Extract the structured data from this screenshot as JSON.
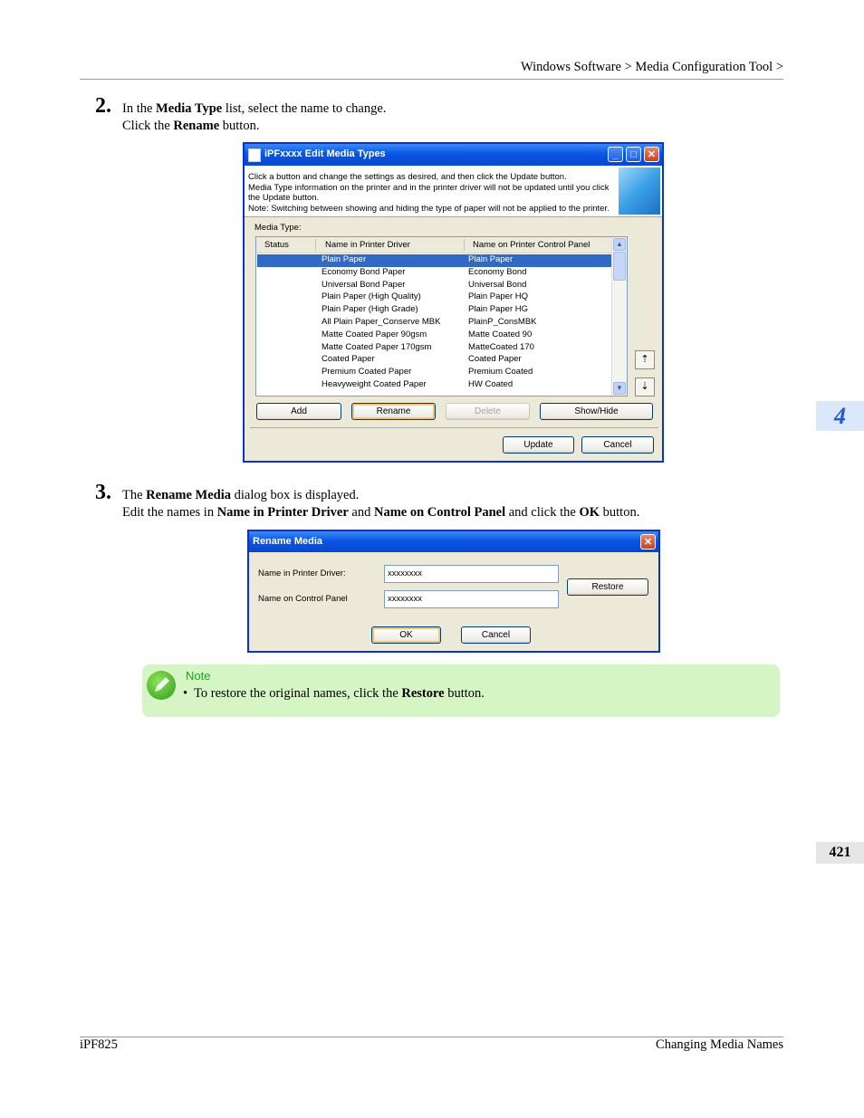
{
  "header": {
    "breadcrumb_1": "Windows Software",
    "sep_1": ">",
    "breadcrumb_2": "Media Configuration Tool",
    "sep_2": ">"
  },
  "step2": {
    "number": "2.",
    "line1_a": "In the ",
    "line1_b": "Media Type",
    "line1_c": " list, select the name to change.",
    "line2_a": "Click the ",
    "line2_b": "Rename",
    "line2_c": " button."
  },
  "dialog1": {
    "title": "iPFxxxx Edit Media Types",
    "info_line1": "Click a button and change the settings as desired, and then click the Update button.",
    "info_line2": "Media Type information on the printer and in the printer driver will not be updated until you click",
    "info_line3": "the Update button.",
    "info_line4": "Note: Switching between showing and hiding the type of paper will not be applied to the printer.",
    "media_type_label": "Media Type:",
    "columns": [
      "Status",
      "Name in Printer Driver",
      "Name on Printer Control Panel"
    ],
    "rows": [
      {
        "status": "",
        "driver": "Plain Paper",
        "panel": "Plain Paper"
      },
      {
        "status": "",
        "driver": "Economy Bond Paper",
        "panel": "Economy Bond"
      },
      {
        "status": "",
        "driver": "Universal Bond Paper",
        "panel": "Universal Bond"
      },
      {
        "status": "",
        "driver": "Plain Paper (High Quality)",
        "panel": "Plain Paper HQ"
      },
      {
        "status": "",
        "driver": "Plain Paper (High Grade)",
        "panel": "Plain Paper HG"
      },
      {
        "status": "",
        "driver": "All Plain Paper_Conserve MBK",
        "panel": "PlainP_ConsMBK"
      },
      {
        "status": "",
        "driver": "Matte Coated Paper 90gsm",
        "panel": "Matte Coated 90"
      },
      {
        "status": "",
        "driver": "Matte Coated Paper 170gsm",
        "panel": "MatteCoated 170"
      },
      {
        "status": "",
        "driver": "Coated Paper",
        "panel": "Coated Paper"
      },
      {
        "status": "",
        "driver": "Premium Coated Paper",
        "panel": "Premium Coated"
      },
      {
        "status": "",
        "driver": "Heavyweight Coated Paper",
        "panel": "HW Coated"
      }
    ],
    "selected_index": 0,
    "buttons": {
      "add": "Add",
      "rename": "Rename",
      "delete": "Delete",
      "show_hide": "Show/Hide",
      "update": "Update",
      "cancel": "Cancel"
    }
  },
  "step3": {
    "number": "3.",
    "line1_a": "The ",
    "line1_b": "Rename Media",
    "line1_c": " dialog box is displayed.",
    "line2_a": "Edit the names in ",
    "line2_b": "Name in Printer Driver",
    "line2_c": " and ",
    "line2_d": "Name on Control Panel",
    "line2_e": " and click the ",
    "line2_f": "OK",
    "line2_g": " button."
  },
  "dialog2": {
    "title": "Rename Media",
    "driver_label": "Name in Printer Driver:",
    "driver_value": "xxxxxxxx",
    "panel_label": "Name on Control Panel",
    "panel_value": "xxxxxxxx",
    "restore": "Restore",
    "ok": "OK",
    "cancel": "Cancel"
  },
  "note": {
    "heading": "Note",
    "bullet": "•",
    "text_a": "To restore the original names, click the ",
    "text_b": "Restore",
    "text_c": " button."
  },
  "side_tab": "4",
  "page_number": "421",
  "footer": {
    "left": "iPF825",
    "right": "Changing Media Names"
  },
  "colors": {
    "note_bg": "#d5f5c4",
    "tab_bg": "#dbe7fb",
    "tab_text": "#2657d6",
    "xp_title": "#0a55e3",
    "selection": "#316ac5"
  }
}
